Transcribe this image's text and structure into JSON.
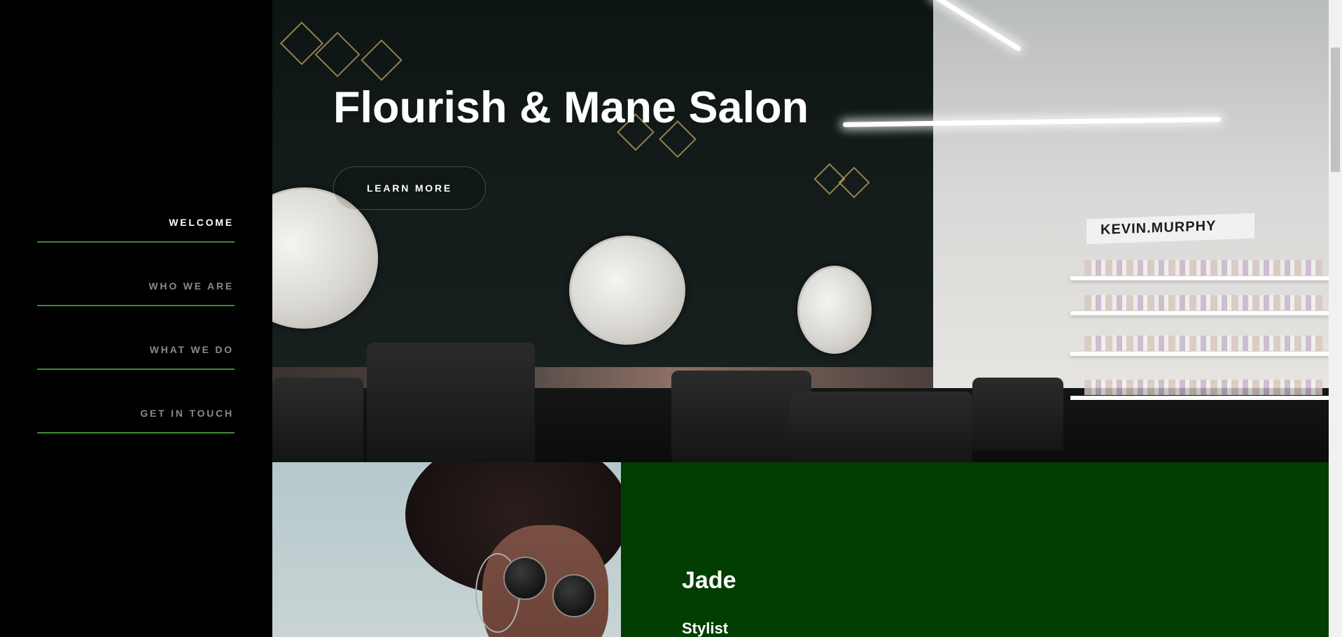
{
  "sidebar": {
    "nav_items": [
      {
        "label": "WELCOME",
        "active": true
      },
      {
        "label": "WHO WE ARE",
        "active": false
      },
      {
        "label": "WHAT WE DO",
        "active": false
      },
      {
        "label": "GET IN TOUCH",
        "active": false
      }
    ]
  },
  "hero": {
    "title": "Flourish & Mane Salon",
    "cta_label": "LEARN MORE",
    "sign_text": "KEVIN.MURPHY"
  },
  "profile": {
    "name": "Jade",
    "role": "Stylist"
  },
  "colors": {
    "accent_rule": "#3d8a32",
    "profile_bg": "#023d02",
    "sidebar_bg": "#000000",
    "nav_inactive": "#8a8a8a",
    "nav_active": "#ffffff"
  }
}
